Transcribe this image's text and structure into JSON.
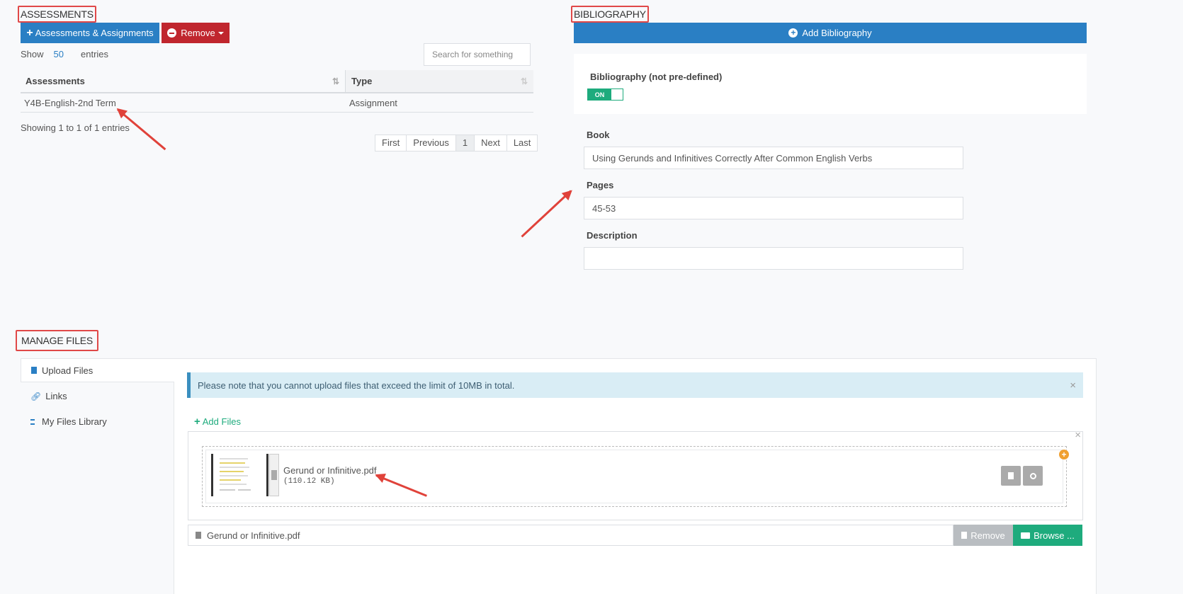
{
  "assessments": {
    "title": "ASSESSMENTS",
    "add_button_label": "Assessments & Assignments",
    "add_button_icon": "plus-icon",
    "remove_button_label": "Remove",
    "remove_button_icon": "minus-circle-icon",
    "show_label": "Show",
    "entries_value": "50",
    "entries_label": "entries",
    "search_placeholder": "Search for something",
    "table": {
      "columns": [
        "Assessments",
        "Type"
      ],
      "rows": [
        {
          "assessment": "Y4B-English-2nd Term",
          "type": "Assignment"
        }
      ]
    },
    "info": "Showing 1 to 1 of 1 entries",
    "pagination": [
      "First",
      "Previous",
      "1",
      "Next",
      "Last"
    ]
  },
  "bibliography": {
    "title": "BIBLIOGRAPHY",
    "add_button_label": "Add Bibliography",
    "add_button_icon": "plus-circle-icon",
    "toggle_label": "Bibliography (not pre-defined)",
    "toggle_state": "ON",
    "book_label": "Book",
    "book_value": "Using Gerunds and Infinitives Correctly After Common English Verbs",
    "pages_label": "Pages",
    "pages_value": "45-53",
    "description_label": "Description",
    "description_value": ""
  },
  "manage_files": {
    "title": "MANAGE FILES",
    "tabs": [
      {
        "label": "Upload Files",
        "icon": "file-icon",
        "active": true
      },
      {
        "label": "Links",
        "icon": "link-icon",
        "active": false
      },
      {
        "label": "My Files Library",
        "icon": "library-icon",
        "active": false
      }
    ],
    "notice": "Please note that you cannot upload files that exceed the limit of 10MB in total.",
    "add_files_label": "Add Files",
    "file": {
      "name": "Gerund or Infinitive.pdf",
      "size": "(110.12 KB)"
    },
    "file_input_value": "Gerund or Infinitive.pdf",
    "remove_label": "Remove",
    "browse_label": "Browse ..."
  },
  "colors": {
    "primary_blue": "#2a7fc4",
    "danger_red": "#c0262e",
    "success_green": "#1eab7d",
    "annotation_red": "#e0423a"
  }
}
